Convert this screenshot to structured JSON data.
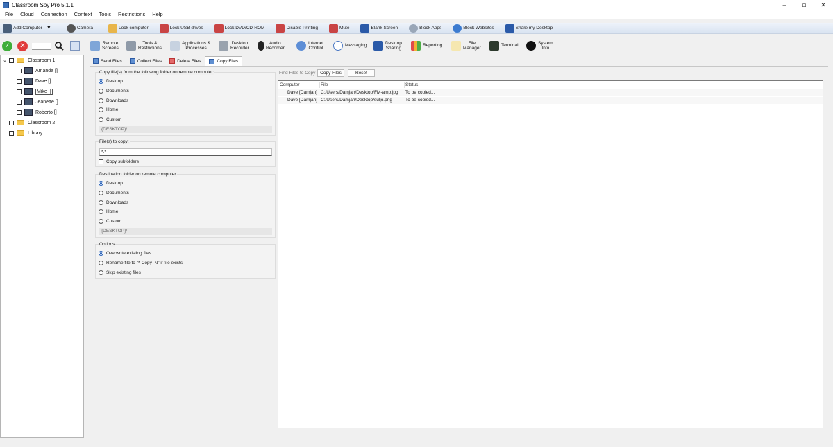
{
  "window": {
    "title": "Classroom Spy Pro 5.1.1",
    "controls": [
      "–",
      "⧉",
      "✕"
    ]
  },
  "menu": [
    "File",
    "Cloud",
    "Connection",
    "Context",
    "Tools",
    "Restrictions",
    "Help"
  ],
  "toolbar1": [
    {
      "label": "Add Computer",
      "icon": "add-computer-icon",
      "color": "#4a5f7a"
    },
    {
      "label": "Camera",
      "icon": "camera-icon",
      "color": "#555555"
    },
    {
      "label": "Lock computer",
      "icon": "lock-icon",
      "color": "#e8b54a"
    },
    {
      "label": "Lock USB drives",
      "icon": "usb-lock-icon",
      "color": "#c94444"
    },
    {
      "label": "Lock DVD/CD-ROM",
      "icon": "dvd-lock-icon",
      "color": "#c94444"
    },
    {
      "label": "Disable Printing",
      "icon": "printer-icon",
      "color": "#c94444"
    },
    {
      "label": "Mute",
      "icon": "mute-icon",
      "color": "#c94444"
    },
    {
      "label": "Blank Screen",
      "icon": "monitor-icon",
      "color": "#2b5aa8"
    },
    {
      "label": "Block Apps",
      "icon": "block-apps-icon",
      "color": "#9aa7b8"
    },
    {
      "label": "Block Websites",
      "icon": "globe-icon",
      "color": "#3c7bd0"
    },
    {
      "label": "Share my Desktop",
      "icon": "share-desktop-icon",
      "color": "#2b5aa8"
    }
  ],
  "toolbar2": [
    {
      "label": "Remote\nScreens",
      "icon": "remote-screens-icon"
    },
    {
      "label": "Tools &\nRestrictions",
      "icon": "tools-icon"
    },
    {
      "label": "Applications &\nProcesses",
      "icon": "applications-icon"
    },
    {
      "label": "Desktop\nRecorder",
      "icon": "desktop-recorder-icon"
    },
    {
      "label": "Audio\nRecorder",
      "icon": "microphone-icon"
    },
    {
      "label": "Internet\nControl",
      "icon": "internet-icon"
    },
    {
      "label": "Messaging",
      "icon": "messaging-icon"
    },
    {
      "label": "Desktop\nSharing",
      "icon": "desktop-sharing-icon"
    },
    {
      "label": "Reporting",
      "icon": "reporting-icon"
    },
    {
      "label": "File\nManager",
      "icon": "file-manager-icon"
    },
    {
      "label": "Terminal",
      "icon": "terminal-icon"
    },
    {
      "label": "System\nInfo",
      "icon": "info-icon"
    }
  ],
  "tree": {
    "groups": [
      {
        "name": "Classroom 1",
        "computers": [
          "Amanda []",
          "Dave []",
          "Mike []",
          "Jeanette []",
          "Roberto []"
        ]
      },
      {
        "name": "Classroom 2",
        "computers": []
      },
      {
        "name": "Library",
        "computers": []
      }
    ]
  },
  "tabs": [
    "Send Files",
    "Collect Files",
    "Delete Files",
    "Copy Files"
  ],
  "copy": {
    "source_title": "Copy file(s) from the following folder on remote computer:",
    "source_options": [
      "Desktop",
      "Documents",
      "Downloads",
      "Home",
      "Custom"
    ],
    "source_selected": "Desktop",
    "source_path": "{DESKTOP}/",
    "files_title": "File(s) to copy:",
    "files_value": "*.*",
    "copy_subfolders": "Copy subfolders",
    "dest_title": "Destination folder on remote computer",
    "dest_options": [
      "Desktop",
      "Documents",
      "Downloads",
      "Home",
      "Custom"
    ],
    "dest_selected": "Desktop",
    "dest_path": "{DESKTOP}/",
    "options_title": "Options",
    "options": [
      "Overwrite existing files",
      "Rename file to \"*-Copy_N\" if file exists",
      "Skip existing files"
    ],
    "option_selected": "Overwrite existing files"
  },
  "find": {
    "label": "Find Files to Copy",
    "copy_button": "Copy Files",
    "reset_button": "Reset"
  },
  "table": {
    "columns": [
      "Computer",
      "File",
      "Status"
    ],
    "rows": [
      {
        "computer": "Dave [Damjan]",
        "file": "C:/Users/Damjan/Desktop/FM-amp.jpg",
        "status": "To be copied..."
      },
      {
        "computer": "Dave [Damjan]",
        "file": "C:/Users/Damjan/Desktop/suljo.png",
        "status": "To be copied..."
      }
    ]
  }
}
